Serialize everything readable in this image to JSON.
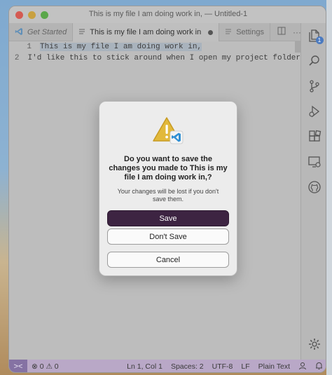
{
  "window": {
    "title": "This is my file I am doing work in, — Untitled-1"
  },
  "tabs": [
    {
      "label": "Get Started",
      "icon": "vscode-logo-icon"
    },
    {
      "label": "This is my file I am doing work in",
      "icon": "lines-icon",
      "modified": true
    },
    {
      "label": "Settings",
      "icon": "lines-icon"
    }
  ],
  "editor": {
    "lines": [
      {
        "num": "1",
        "text": "This is my file I am doing work in,"
      },
      {
        "num": "2",
        "text": "I'd like this to stick around when I open my project folder"
      }
    ]
  },
  "activity_bar": [
    {
      "name": "explorer-icon",
      "badge": "1"
    },
    {
      "name": "search-icon"
    },
    {
      "name": "source-control-icon"
    },
    {
      "name": "run-debug-icon"
    },
    {
      "name": "extensions-icon"
    },
    {
      "name": "remote-explorer-icon"
    },
    {
      "name": "github-icon"
    },
    {
      "name": "gear-icon"
    }
  ],
  "statusbar": {
    "remote": "><",
    "problems": "⊗ 0 ⚠ 0",
    "position": "Ln 1, Col 1",
    "spaces": "Spaces: 2",
    "encoding": "UTF-8",
    "eol": "LF",
    "language": "Plain Text"
  },
  "dialog": {
    "title": "Do you want to save the changes you made to This is my file I am doing work in,?",
    "message": "Your changes will be lost if you don't save them.",
    "save": "Save",
    "dont_save": "Don't Save",
    "cancel": "Cancel"
  },
  "colors": {
    "accent_primary_button": "#3d2442",
    "statusbar": "#b9a8c7",
    "badge": "#4a7ac0"
  }
}
